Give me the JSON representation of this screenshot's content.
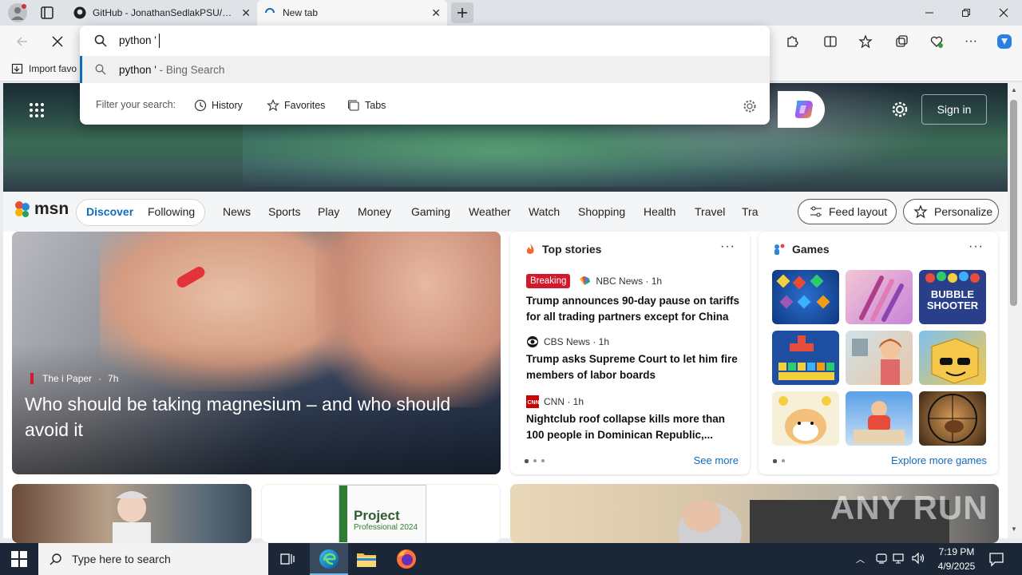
{
  "browser": {
    "tabs": [
      {
        "title": "GitHub - JonathanSedlakPSU/Dis"
      },
      {
        "title": "New tab"
      }
    ],
    "favorites_bar": {
      "import_label": "Import favo"
    }
  },
  "omnibox": {
    "query": "python '",
    "suggestion_query": "python '",
    "suggestion_suffix": " - Bing Search",
    "filter_label": "Filter your search:",
    "filters": [
      "History",
      "Favorites",
      "Tabs"
    ]
  },
  "msn": {
    "sign_in": "Sign in",
    "logo": "msn",
    "tabs": [
      "Discover",
      "Following"
    ],
    "nav": [
      "News",
      "Sports",
      "Play",
      "Money",
      "Gaming",
      "Weather",
      "Watch",
      "Shopping",
      "Health",
      "Travel",
      "Tra"
    ],
    "feed_layout": "Feed layout",
    "personalize": "Personalize",
    "main_story": {
      "source": "The i Paper",
      "age": "7h",
      "title": "Who should be taking magnesium – and who should avoid it"
    },
    "top_stories": {
      "heading": "Top stories",
      "items": [
        {
          "badge": "Breaking",
          "source": "NBC News · 1h",
          "title": "Trump announces 90-day pause on tariffs for all trading partners except for China"
        },
        {
          "source": "CBS News · 1h",
          "title": "Trump asks Supreme Court to let him fire members of labor boards"
        },
        {
          "source": "CNN · 1h",
          "title": "Nightclub roof collapse kills more than 100 people in Dominican Republic,..."
        }
      ],
      "see_more": "See more"
    },
    "games": {
      "heading": "Games",
      "explore": "Explore more games",
      "tile_text": [
        "BUBBLE",
        "SHOOTER"
      ]
    },
    "bottom_ad": {
      "title": "Project",
      "subtitle": "Professional 2024"
    }
  },
  "watermark": "ANY RUN",
  "taskbar": {
    "search_placeholder": "Type here to search",
    "time": "7:19 PM",
    "date": "4/9/2025"
  }
}
